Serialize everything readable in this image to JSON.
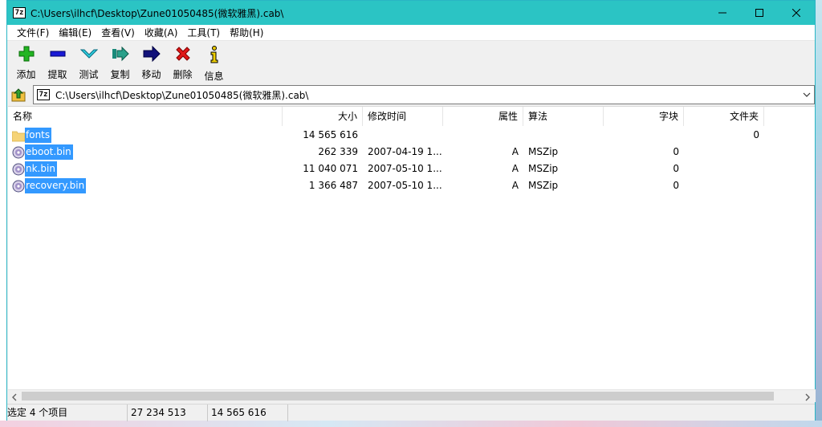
{
  "window": {
    "title": "C:\\Users\\ilhcf\\Desktop\\Zune01050485(微软雅黑).cab\\",
    "app_icon_text": "7z",
    "colors": {
      "titlebar": "#2bc4c4",
      "selection": "#3399ff"
    }
  },
  "menu": [
    "文件(F)",
    "编辑(E)",
    "查看(V)",
    "收藏(A)",
    "工具(T)",
    "帮助(H)"
  ],
  "toolbar": [
    {
      "label": "添加",
      "icon": "add-icon"
    },
    {
      "label": "提取",
      "icon": "extract-icon"
    },
    {
      "label": "测试",
      "icon": "test-icon"
    },
    {
      "label": "复制",
      "icon": "copy-icon"
    },
    {
      "label": "移动",
      "icon": "move-icon"
    },
    {
      "label": "删除",
      "icon": "delete-icon"
    },
    {
      "label": "信息",
      "icon": "info-icon"
    }
  ],
  "address": {
    "path": "C:\\Users\\ilhcf\\Desktop\\Zune01050485(微软雅黑).cab\\"
  },
  "columns": [
    "名称",
    "大小",
    "修改时间",
    "属性",
    "算法",
    "字块",
    "文件夹"
  ],
  "rows": [
    {
      "name": "fonts",
      "type": "folder",
      "size": "14 565 616",
      "modified": "",
      "attr": "",
      "method": "",
      "block": "",
      "folders": "0"
    },
    {
      "name": "eboot.bin",
      "type": "file",
      "size": "262 339",
      "modified": "2007-04-19 1...",
      "attr": "A",
      "method": "MSZip",
      "block": "0",
      "folders": ""
    },
    {
      "name": "nk.bin",
      "type": "file",
      "size": "11 040 071",
      "modified": "2007-05-10 1...",
      "attr": "A",
      "method": "MSZip",
      "block": "0",
      "folders": ""
    },
    {
      "name": "recovery.bin",
      "type": "file",
      "size": "1 366 487",
      "modified": "2007-05-10 1...",
      "attr": "A",
      "method": "MSZip",
      "block": "0",
      "folders": ""
    }
  ],
  "status": {
    "selected": "选定 4 个项目",
    "total_size": "27 234 513",
    "selected_size": "14 565 616"
  }
}
